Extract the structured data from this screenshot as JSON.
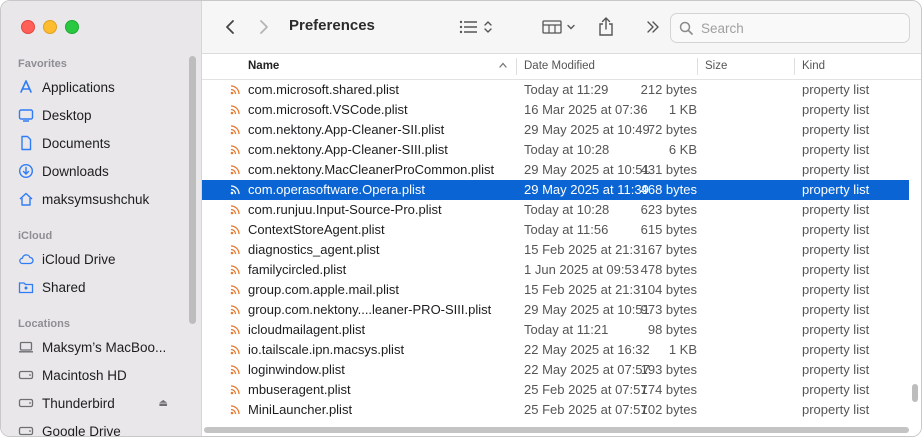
{
  "toolbar": {
    "title": "Preferences",
    "search_placeholder": "Search"
  },
  "sidebar": {
    "sections": [
      {
        "title": "Favorites",
        "items": [
          {
            "label": "Applications",
            "icon": "applications-icon"
          },
          {
            "label": "Desktop",
            "icon": "desktop-icon"
          },
          {
            "label": "Documents",
            "icon": "document-icon"
          },
          {
            "label": "Downloads",
            "icon": "downloads-icon"
          },
          {
            "label": "maksymsushchuk",
            "icon": "home-icon"
          }
        ]
      },
      {
        "title": "iCloud",
        "items": [
          {
            "label": "iCloud Drive",
            "icon": "cloud-icon"
          },
          {
            "label": "Shared",
            "icon": "shared-folder-icon"
          }
        ]
      },
      {
        "title": "Locations",
        "items": [
          {
            "label": "Maksym’s MacBoo...",
            "icon": "laptop-icon"
          },
          {
            "label": "Macintosh HD",
            "icon": "disk-icon"
          },
          {
            "label": "Thunderbird",
            "icon": "disk-icon"
          },
          {
            "label": "Google Drive",
            "icon": "disk-icon"
          }
        ]
      }
    ]
  },
  "table": {
    "columns": {
      "name": "Name",
      "date": "Date Modified",
      "size": "Size",
      "kind": "Kind"
    },
    "rows": [
      {
        "name": "com.microsoft.shared.plist",
        "date": "Today at 11:29",
        "size": "212 bytes",
        "kind": "property list"
      },
      {
        "name": "com.microsoft.VSCode.plist",
        "date": "16 Mar 2025 at 07:36",
        "size": "1 KB",
        "kind": "property list"
      },
      {
        "name": "com.nektony.App-Cleaner-SII.plist",
        "date": "29 May 2025 at 10:49",
        "size": "72 bytes",
        "kind": "property list"
      },
      {
        "name": "com.nektony.App-Cleaner-SIII.plist",
        "date": "Today at 10:28",
        "size": "6 KB",
        "kind": "property list"
      },
      {
        "name": "com.nektony.MacCleanerProCommon.plist",
        "date": "29 May 2025 at 10:51",
        "size": "431 bytes",
        "kind": "property list"
      },
      {
        "name": "com.operasoftware.Opera.plist",
        "date": "29 May 2025 at 11:39",
        "size": "468 bytes",
        "kind": "property list",
        "selected": true
      },
      {
        "name": "com.runjuu.Input-Source-Pro.plist",
        "date": "Today at 10:28",
        "size": "623 bytes",
        "kind": "property list"
      },
      {
        "name": "ContextStoreAgent.plist",
        "date": "Today at 11:56",
        "size": "615 bytes",
        "kind": "property list"
      },
      {
        "name": "diagnostics_agent.plist",
        "date": "15 Feb 2025 at 21:31",
        "size": "67 bytes",
        "kind": "property list"
      },
      {
        "name": "familycircled.plist",
        "date": "1 Jun 2025 at 09:53",
        "size": "478 bytes",
        "kind": "property list"
      },
      {
        "name": "group.com.apple.mail.plist",
        "date": "15 Feb 2025 at 21:31",
        "size": "104 bytes",
        "kind": "property list"
      },
      {
        "name": "group.com.nektony....leaner-PRO-SIII.plist",
        "date": "29 May 2025 at 10:51",
        "size": "973 bytes",
        "kind": "property list"
      },
      {
        "name": "icloudmailagent.plist",
        "date": "Today at 11:21",
        "size": "98 bytes",
        "kind": "property list"
      },
      {
        "name": "io.tailscale.ipn.macsys.plist",
        "date": "22 May 2025 at 16:32",
        "size": "1 KB",
        "kind": "property list"
      },
      {
        "name": "loginwindow.plist",
        "date": "22 May 2025 at 07:57",
        "size": "193 bytes",
        "kind": "property list"
      },
      {
        "name": "mbuseragent.plist",
        "date": "25 Feb 2025 at 07:57",
        "size": "174 bytes",
        "kind": "property list"
      },
      {
        "name": "MiniLauncher.plist",
        "date": "25 Feb 2025 at 07:57",
        "size": "102 bytes",
        "kind": "property list"
      }
    ]
  },
  "colors": {
    "accent": "#2f7cf6",
    "selection": "#0a64d3",
    "plist_icon": "#e8782a"
  }
}
